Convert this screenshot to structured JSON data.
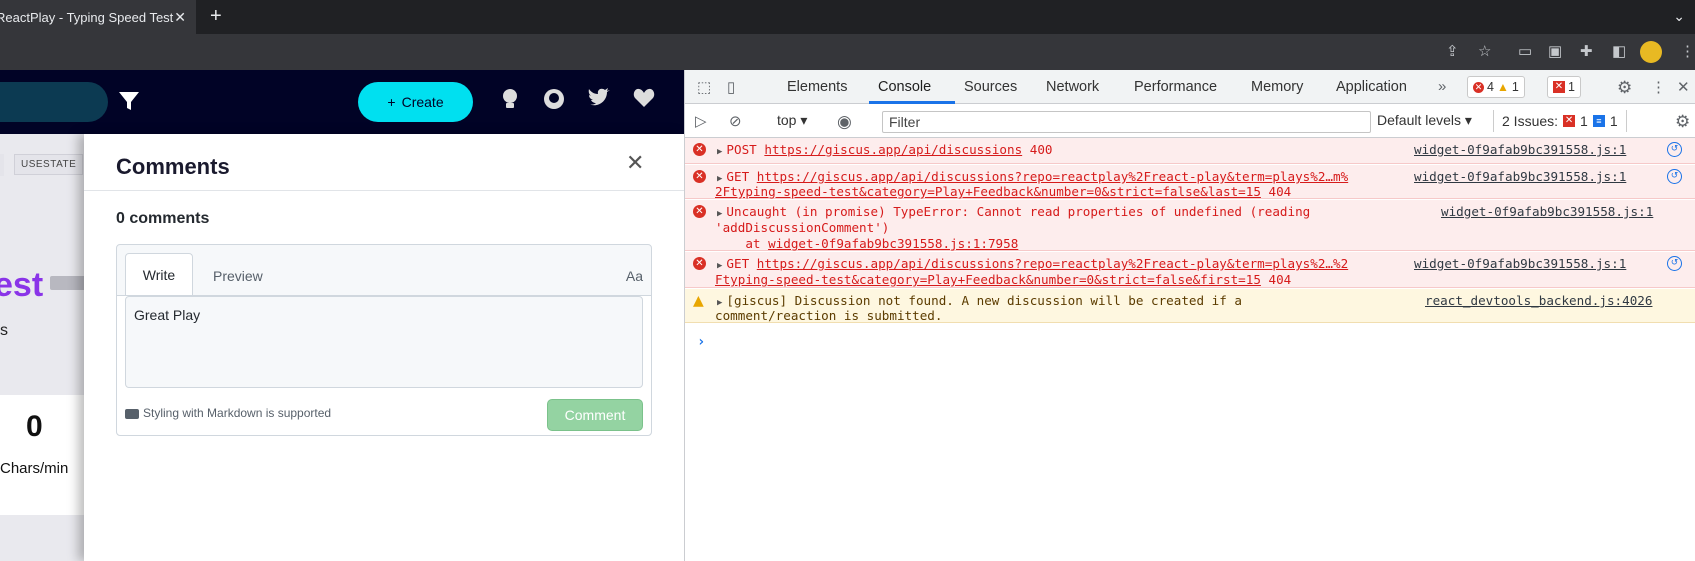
{
  "browser": {
    "tab_title": "ReactPlay - Typing Speed Test",
    "close_glyph": "✕",
    "new_tab_glyph": "+"
  },
  "page": {
    "create_label": "Create",
    "chip_label": "USESTATE",
    "title_fragment": "est",
    "subtitle_fragment": "s",
    "stat_value": "0",
    "stat_label": "Chars/min"
  },
  "comments": {
    "title": "Comments",
    "count": "0 comments",
    "tab_write": "Write",
    "tab_preview": "Preview",
    "format_label": "Aa",
    "textarea_value": "Great Play",
    "markdown_note": "Styling with Markdown is supported",
    "submit_label": "Comment"
  },
  "devtools": {
    "tabs": [
      "Elements",
      "Console",
      "Sources",
      "Network",
      "Performance",
      "Memory",
      "Application"
    ],
    "active_tab": "Console",
    "error_count": "4",
    "warning_count": "1",
    "issue_badge_count": "1",
    "context": "top",
    "filter_placeholder": "Filter",
    "levels": "Default levels",
    "issues_label": "2 Issues:",
    "issues_errors": "1",
    "issues_info": "1",
    "messages": [
      {
        "level": "error",
        "method": "POST",
        "url": "https://giscus.app/api/discussions",
        "status": "400",
        "source": "widget-0f9afab9bc391558.js:1"
      },
      {
        "level": "error",
        "method": "GET",
        "url_line1": "https://giscus.app/api/discussions?repo=reactplay%2Freact-play&term=plays%2…m%",
        "url_line2": "2Ftyping-speed-test&category=Play+Feedback&number=0&strict=false&last=15",
        "status": "404",
        "source": "widget-0f9afab9bc391558.js:1"
      },
      {
        "level": "error",
        "line1": "Uncaught (in promise) TypeError: Cannot read properties of undefined (reading",
        "line2": "'addDiscussionComment')",
        "line3_prefix": "    at ",
        "line3_link": "widget-0f9afab9bc391558.js:1:7958",
        "source": "widget-0f9afab9bc391558.js:1"
      },
      {
        "level": "error",
        "method": "GET",
        "url_line1": "https://giscus.app/api/discussions?repo=reactplay%2Freact-play&term=plays%2…%2",
        "url_line2": "Ftyping-speed-test&category=Play+Feedback&number=0&strict=false&first=15",
        "status": "404",
        "source": "widget-0f9afab9bc391558.js:1"
      },
      {
        "level": "warning",
        "line1": "[giscus] Discussion not found. A new discussion will be created if a",
        "line2": "comment/reaction is submitted.",
        "source": "react_devtools_backend.js:4026"
      }
    ]
  }
}
